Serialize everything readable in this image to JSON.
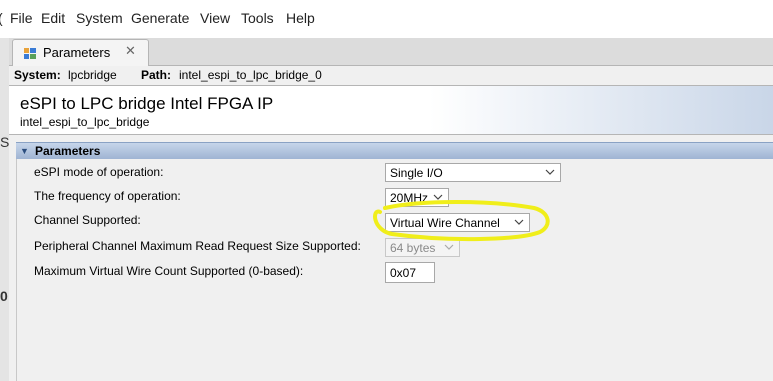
{
  "menu": {
    "items": [
      "File",
      "Edit",
      "System",
      "Generate",
      "View",
      "Tools",
      "Help"
    ]
  },
  "tab": {
    "label": "Parameters"
  },
  "pathbar": {
    "system_label": "System:",
    "system_value": "lpcbridge",
    "path_label": "Path:",
    "path_value": "intel_espi_to_lpc_bridge_0"
  },
  "header": {
    "title": "eSPI to LPC bridge Intel FPGA IP",
    "subtitle": "intel_espi_to_lpc_bridge"
  },
  "section": {
    "label": "Parameters"
  },
  "params": {
    "mode": {
      "label": "eSPI mode of operation:",
      "value": "Single I/O"
    },
    "freq": {
      "label": "The frequency of operation:",
      "value": "20MHz"
    },
    "channel": {
      "label": "Channel Supported:",
      "value": "Virtual Wire Channel"
    },
    "periph": {
      "label": "Peripheral Channel Maximum Read Request Size Supported:",
      "value": "64 bytes"
    },
    "vwcount": {
      "label": "Maximum Virtual Wire Count Supported (0-based):",
      "value": "0x07"
    }
  },
  "left_fragments": [
    "S",
    "0"
  ],
  "colors": {
    "highlight": "#f0ee1a",
    "section_bg": "#b3c5df"
  }
}
